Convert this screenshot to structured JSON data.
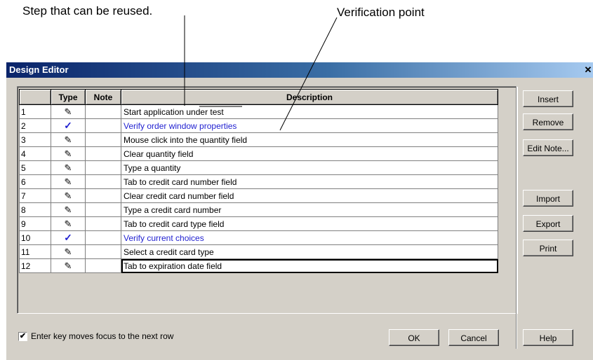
{
  "callouts": {
    "reusable_step": "Step that can be reused.",
    "verification_point": "Verification point"
  },
  "window": {
    "title": "Design Editor",
    "close_glyph": "✕"
  },
  "grid": {
    "headers": {
      "number": "",
      "type": "Type",
      "note": "Note",
      "description": "Description"
    },
    "rows": [
      {
        "num": "1",
        "type": "step",
        "type_glyph": "✎",
        "note": "",
        "description": "Start application under test"
      },
      {
        "num": "2",
        "type": "verification",
        "type_glyph": "✓",
        "note": "",
        "description": "Verify order window properties"
      },
      {
        "num": "3",
        "type": "step",
        "type_glyph": "✎",
        "note": "",
        "description": "Mouse click into the quantity field"
      },
      {
        "num": "4",
        "type": "step",
        "type_glyph": "✎",
        "note": "",
        "description": "Clear quantity field"
      },
      {
        "num": "5",
        "type": "step",
        "type_glyph": "✎",
        "note": "",
        "description": "Type a quantity"
      },
      {
        "num": "6",
        "type": "step",
        "type_glyph": "✎",
        "note": "",
        "description": "Tab to credit card number field"
      },
      {
        "num": "7",
        "type": "step",
        "type_glyph": "✎",
        "note": "",
        "description": "Clear credit card number field"
      },
      {
        "num": "8",
        "type": "step",
        "type_glyph": "✎",
        "note": "",
        "description": "Type a credit card number"
      },
      {
        "num": "9",
        "type": "step",
        "type_glyph": "✎",
        "note": "",
        "description": "Tab to credit card type field"
      },
      {
        "num": "10",
        "type": "verification",
        "type_glyph": "✓",
        "note": "",
        "description": "Verify current choices"
      },
      {
        "num": "11",
        "type": "step",
        "type_glyph": "✎",
        "note": "",
        "description": "Select a credit card type"
      },
      {
        "num": "12",
        "type": "step",
        "type_glyph": "✎",
        "note": "",
        "description": "Tab to expiration date field"
      }
    ]
  },
  "buttons": {
    "insert": "Insert",
    "remove": "Remove",
    "edit_note": "Edit Note...",
    "import": "Import",
    "export": "Export",
    "print": "Print",
    "ok": "OK",
    "cancel": "Cancel",
    "help": "Help"
  },
  "options": {
    "enter_key_label": "Enter key moves focus to the next row",
    "enter_key_checked": true,
    "check_glyph": "✔"
  },
  "colors": {
    "verification_text": "#1f1fd0",
    "title_bar_start": "#0a246a",
    "dialog_face": "#d4d0c8"
  }
}
